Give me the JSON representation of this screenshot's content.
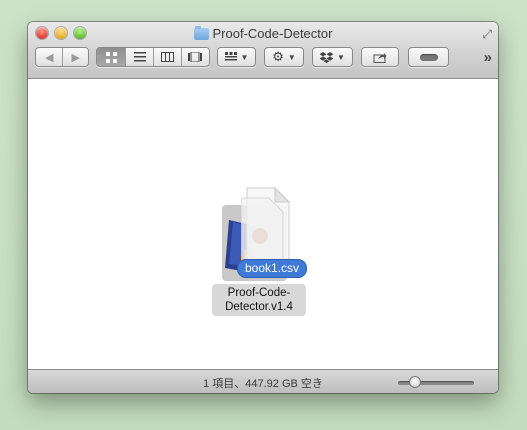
{
  "window": {
    "title": "Proof-Code-Detector"
  },
  "toolbar": {
    "back_icon": "chevron-left-icon",
    "forward_icon": "chevron-right-icon",
    "view_modes": [
      "icon-view",
      "list-view",
      "column-view",
      "coverflow-view"
    ],
    "active_view": "icon-view",
    "arrange_icon": "arrange-grid-icon",
    "action_icon": "gear-icon",
    "dropbox_icon": "dropbox-icon",
    "share_icon": "share-icon",
    "tag_icon": "tag-pill-icon",
    "overflow_icon": "double-chevron-right-icon"
  },
  "items": [
    {
      "name": "Proof-Code-\nDetector.v1.4",
      "name_line1": "Proof-Code-",
      "name_line2": "Detector.v1.4",
      "selected": true
    }
  ],
  "drag": {
    "badge_label": "book1.csv"
  },
  "status": {
    "text": "1 項目、447.92 GB 空き",
    "zoom_level": 0.2
  },
  "colors": {
    "accent": "#3f7ad8",
    "close": "#e0443a",
    "minimize": "#e9b22e",
    "maximize": "#69c23a"
  }
}
